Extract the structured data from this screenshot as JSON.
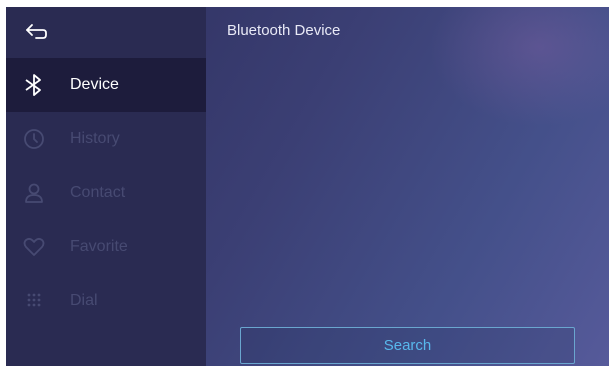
{
  "sidebar": {
    "back_icon": "back-arrow-icon",
    "items": [
      {
        "label": "Device",
        "icon": "bluetooth-icon",
        "state": "active"
      },
      {
        "label": "History",
        "icon": "clock-icon",
        "state": "disabled"
      },
      {
        "label": "Contact",
        "icon": "person-icon",
        "state": "disabled"
      },
      {
        "label": "Favorite",
        "icon": "heart-icon",
        "state": "disabled"
      },
      {
        "label": "Dial",
        "icon": "dialpad-icon",
        "state": "disabled"
      }
    ]
  },
  "main": {
    "title": "Bluetooth Device",
    "search_label": "Search"
  },
  "colors": {
    "sidebar_bg": "#2a2b52",
    "active_item_bg": "#1d1c3c",
    "disabled_text": "#474a72",
    "accent": "#58b8ec"
  }
}
